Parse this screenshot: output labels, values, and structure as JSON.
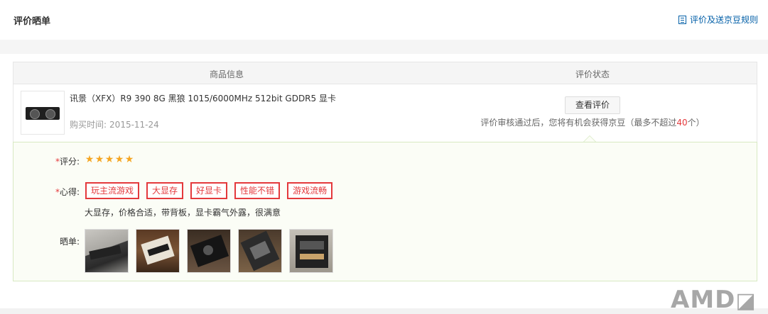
{
  "header": {
    "title": "评价晒单",
    "rules_link": "评价及送京豆规则"
  },
  "table": {
    "col_goods": "商品信息",
    "col_status": "评价状态"
  },
  "product": {
    "name": "讯景（XFX）R9 390 8G 黑狼 1015/6000MHz 512bit GDDR5 显卡",
    "buy_time_label": "购买时间:",
    "buy_time": "2015-11-24"
  },
  "status": {
    "view_button": "查看评价",
    "tip_prefix": "评价审核通过后，您将有机会获得京豆（最多不超过",
    "tip_count": "40",
    "tip_suffix": "个）"
  },
  "review": {
    "score_label": "评分:",
    "rating": 5,
    "star_glyph": "★",
    "tags_label": "心得:",
    "tags": [
      "玩主流游戏",
      "大显存",
      "好显卡",
      "性能不错",
      "游戏流畅"
    ],
    "comment": "大显存，价格合适，带背板，显卡霸气外露，很满意",
    "photos_label": "晒单:",
    "photo_count": 5
  },
  "watermark": "AMD",
  "colors": {
    "accent_red": "#e4393c",
    "link_blue": "#005ea7",
    "star_orange": "#f5a623",
    "panel_bg": "#fbfdf6",
    "panel_border": "#d7e9c2"
  }
}
